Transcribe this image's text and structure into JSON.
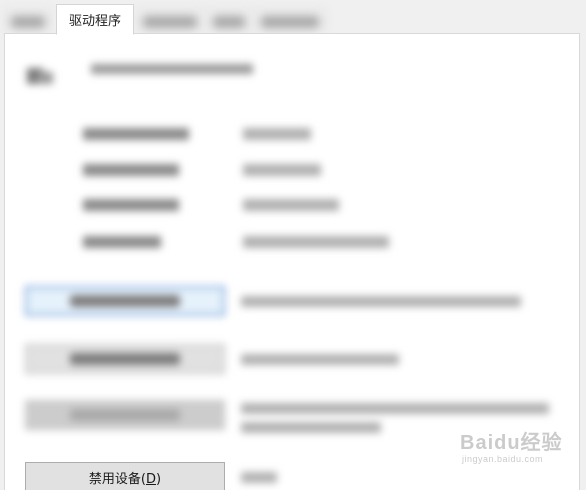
{
  "tabs": [
    {
      "label": "",
      "redacted": true
    },
    {
      "label": "驱动程序",
      "active": true
    },
    {
      "label": "",
      "redacted": true
    },
    {
      "label": "",
      "redacted": true
    },
    {
      "label": "",
      "redacted": true
    }
  ],
  "buttons": {
    "disable_device_prefix": "禁用设备(",
    "disable_device_mnemonic": "D",
    "disable_device_suffix": ")"
  },
  "watermark": {
    "logo_text": "Baidu经验",
    "url_text": "jingyan.baidu.com"
  }
}
